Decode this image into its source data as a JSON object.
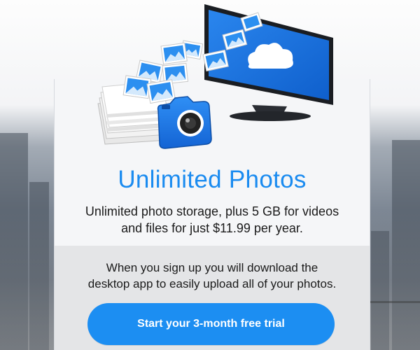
{
  "promo": {
    "title": "Unlimited Photos",
    "subtitle_line1": "Unlimited photo storage, plus 5 GB for videos",
    "subtitle_line2": "and files for just $11.99 per year.",
    "info_line1": "When you sign up you will download the",
    "info_line2": "desktop app to easily upload all of your photos.",
    "cta_label": "Start your 3-month free trial"
  },
  "colors": {
    "accent": "#1a8bf0",
    "button": "#1c8ef2",
    "card_top": "#f5f6f8",
    "card_bottom": "#e4e5e7"
  },
  "icons": [
    "monitor-icon",
    "cloud-icon",
    "camera-icon",
    "photo-stack-icon",
    "flying-photo-icon"
  ]
}
